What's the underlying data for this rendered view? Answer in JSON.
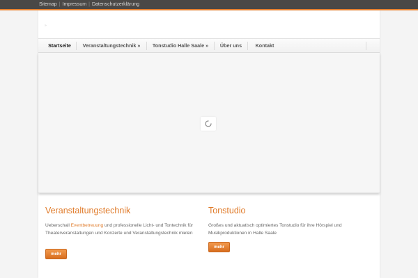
{
  "topbar": {
    "links": [
      "Sitemap",
      "Impressum",
      "Datenschutzerklärung"
    ],
    "separator": "|"
  },
  "logo": {
    "glyph": "»"
  },
  "nav": {
    "items": [
      {
        "label": "Startseite"
      },
      {
        "label": "Veranstaltungstechnik »"
      },
      {
        "label": "Tonstudio Halle Saale »"
      },
      {
        "label": "Über uns"
      },
      {
        "label": "Kontakt"
      }
    ]
  },
  "slider": {
    "loader_icon": "spinner-icon"
  },
  "columns": [
    {
      "title": "Veranstaltungstechnik",
      "text_before": "Ueberschall ",
      "text_link": "Eventbetreuung",
      "text_after": " und professionelle Licht- und Tontechnik für Theaterveranstaltungen und Konzerte und Veranstaltungstechnik mieten",
      "button": "mehr"
    },
    {
      "title": "Tonstudio",
      "text": "Großes und aktuatisch optimiertes Tonstudio für ihre Hörspiel und Musikproduktionen in Halle Saale",
      "button": "mehr"
    }
  ],
  "colors": {
    "accent": "#e07b2a",
    "topbar": "#4a4846"
  }
}
